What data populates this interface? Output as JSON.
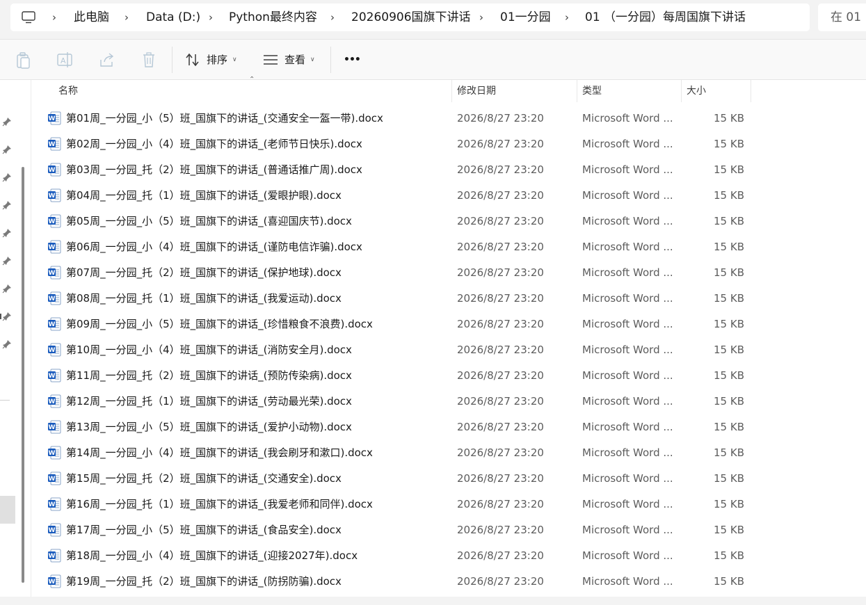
{
  "address": {
    "breadcrumbs": [
      "此电脑",
      "Data (D:)",
      "Python最终内容",
      "20260906国旗下讲话",
      "01一分园",
      "01 （一分园）每周国旗下讲话"
    ],
    "search_placeholder": "在 01"
  },
  "toolbar": {
    "sort_label": "排序",
    "view_label": "查看",
    "more_label": "•••"
  },
  "columns": {
    "name": "名称",
    "date": "修改日期",
    "type": "类型",
    "size": "大小"
  },
  "files": [
    {
      "name": "第01周_一分园_小（5）班_国旗下的讲话_(交通安全一盔一带).docx",
      "date": "2026/8/27 23:20",
      "type": "Microsoft Word ...",
      "size": "15 KB"
    },
    {
      "name": "第02周_一分园_小（4）班_国旗下的讲话_(老师节日快乐).docx",
      "date": "2026/8/27 23:20",
      "type": "Microsoft Word ...",
      "size": "15 KB"
    },
    {
      "name": "第03周_一分园_托（2）班_国旗下的讲话_(普通话推广周).docx",
      "date": "2026/8/27 23:20",
      "type": "Microsoft Word ...",
      "size": "15 KB"
    },
    {
      "name": "第04周_一分园_托（1）班_国旗下的讲话_(爱眼护眼).docx",
      "date": "2026/8/27 23:20",
      "type": "Microsoft Word ...",
      "size": "15 KB"
    },
    {
      "name": "第05周_一分园_小（5）班_国旗下的讲话_(喜迎国庆节).docx",
      "date": "2026/8/27 23:20",
      "type": "Microsoft Word ...",
      "size": "15 KB"
    },
    {
      "name": "第06周_一分园_小（4）班_国旗下的讲话_(谨防电信诈骗).docx",
      "date": "2026/8/27 23:20",
      "type": "Microsoft Word ...",
      "size": "15 KB"
    },
    {
      "name": "第07周_一分园_托（2）班_国旗下的讲话_(保护地球).docx",
      "date": "2026/8/27 23:20",
      "type": "Microsoft Word ...",
      "size": "15 KB"
    },
    {
      "name": "第08周_一分园_托（1）班_国旗下的讲话_(我爱运动).docx",
      "date": "2026/8/27 23:20",
      "type": "Microsoft Word ...",
      "size": "15 KB"
    },
    {
      "name": "第09周_一分园_小（5）班_国旗下的讲话_(珍惜粮食不浪费).docx",
      "date": "2026/8/27 23:20",
      "type": "Microsoft Word ...",
      "size": "15 KB"
    },
    {
      "name": "第10周_一分园_小（4）班_国旗下的讲话_(消防安全月).docx",
      "date": "2026/8/27 23:20",
      "type": "Microsoft Word ...",
      "size": "15 KB"
    },
    {
      "name": "第11周_一分园_托（2）班_国旗下的讲话_(预防传染病).docx",
      "date": "2026/8/27 23:20",
      "type": "Microsoft Word ...",
      "size": "15 KB"
    },
    {
      "name": "第12周_一分园_托（1）班_国旗下的讲话_(劳动最光荣).docx",
      "date": "2026/8/27 23:20",
      "type": "Microsoft Word ...",
      "size": "15 KB"
    },
    {
      "name": "第13周_一分园_小（5）班_国旗下的讲话_(爱护小动物).docx",
      "date": "2026/8/27 23:20",
      "type": "Microsoft Word ...",
      "size": "15 KB"
    },
    {
      "name": "第14周_一分园_小（4）班_国旗下的讲话_(我会刷牙和漱口).docx",
      "date": "2026/8/27 23:20",
      "type": "Microsoft Word ...",
      "size": "15 KB"
    },
    {
      "name": "第15周_一分园_托（2）班_国旗下的讲话_(交通安全).docx",
      "date": "2026/8/27 23:20",
      "type": "Microsoft Word ...",
      "size": "15 KB"
    },
    {
      "name": "第16周_一分园_托（1）班_国旗下的讲话_(我爱老师和同伴).docx",
      "date": "2026/8/27 23:20",
      "type": "Microsoft Word ...",
      "size": "15 KB"
    },
    {
      "name": "第17周_一分园_小（5）班_国旗下的讲话_(食品安全).docx",
      "date": "2026/8/27 23:20",
      "type": "Microsoft Word ...",
      "size": "15 KB"
    },
    {
      "name": "第18周_一分园_小（4）班_国旗下的讲话_(迎接2027年).docx",
      "date": "2026/8/27 23:20",
      "type": "Microsoft Word ...",
      "size": "15 KB"
    },
    {
      "name": "第19周_一分园_托（2）班_国旗下的讲话_(防拐防骗).docx",
      "date": "2026/8/27 23:20",
      "type": "Microsoft Word ...",
      "size": "15 KB"
    }
  ],
  "icons": {
    "file_icon": "word-doc-icon",
    "pin_icon": "pin-icon"
  },
  "colors": {
    "word_blue": "#185abd"
  }
}
